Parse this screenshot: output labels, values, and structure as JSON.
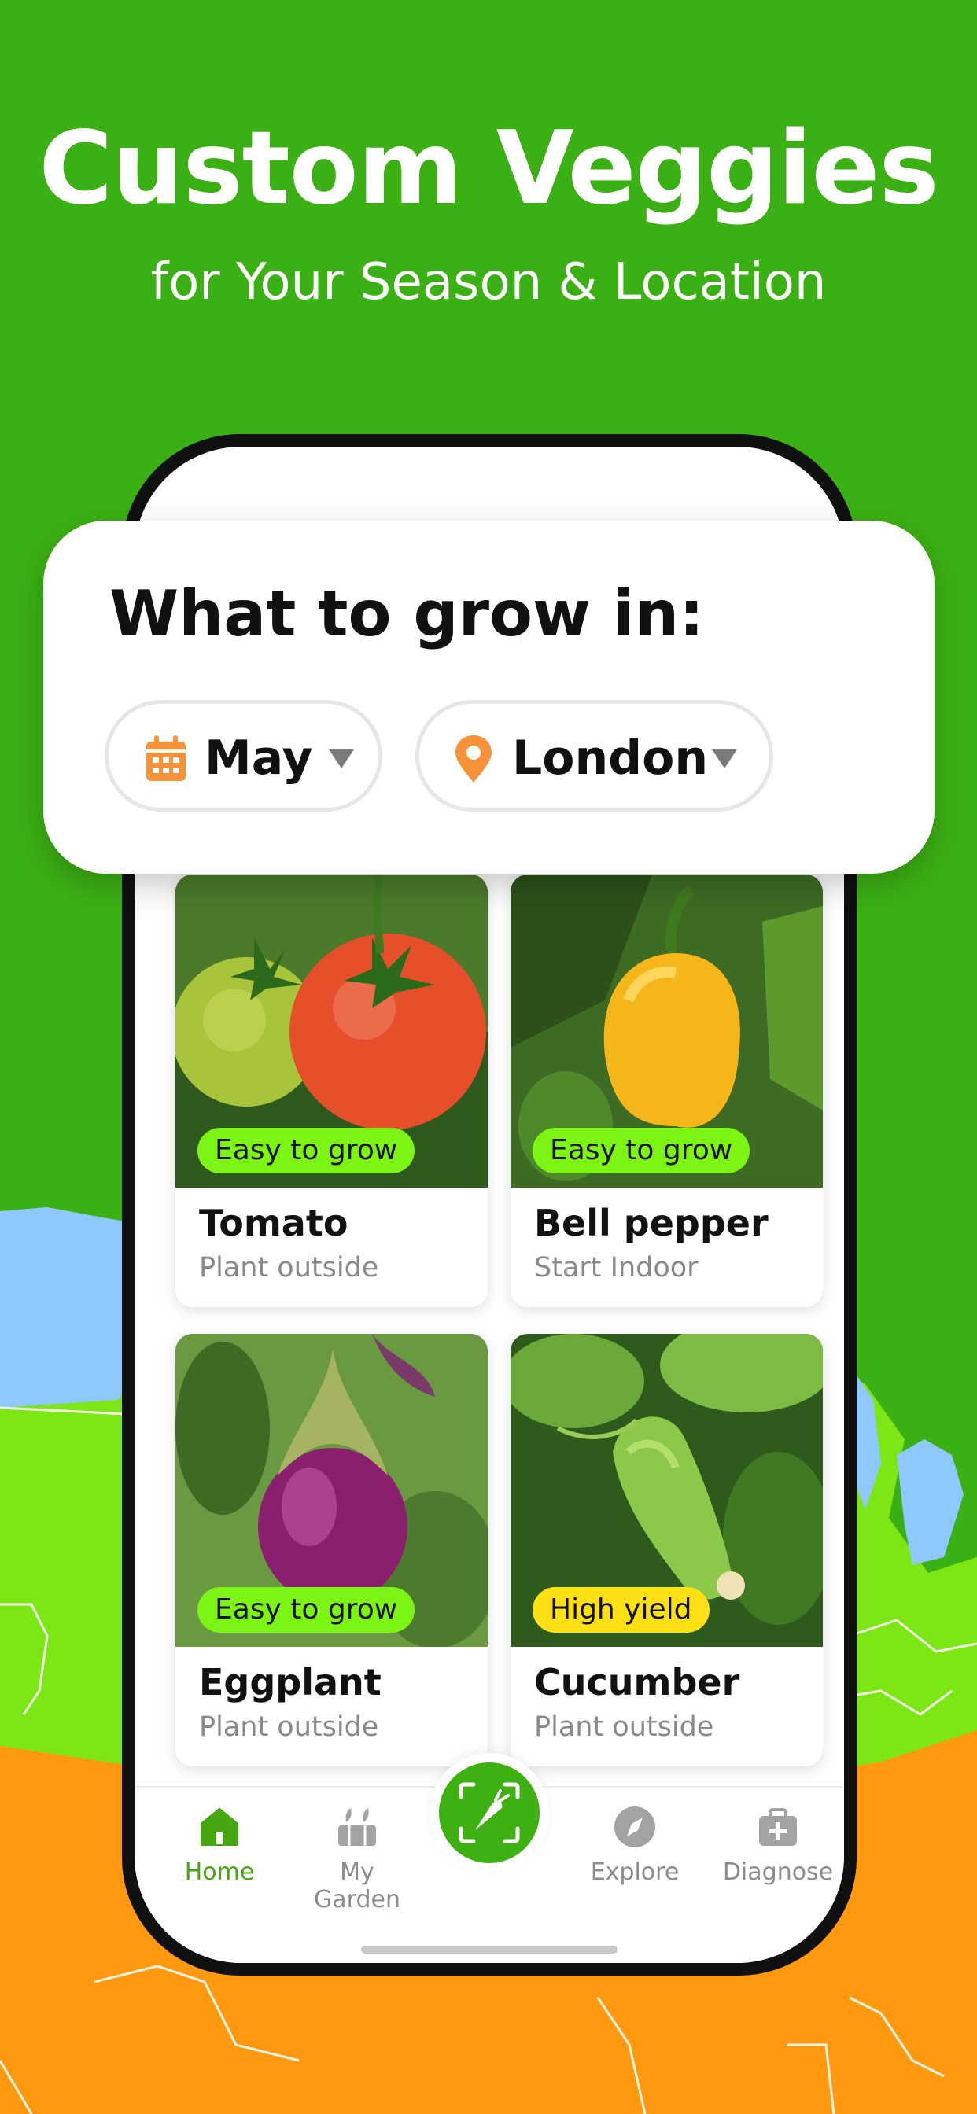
{
  "headline": "Custom Veggies",
  "subheadline": "for Your Season & Location",
  "selector": {
    "title": "What to grow in:",
    "month": "May",
    "location": "London"
  },
  "plants": [
    {
      "name": "Tomato",
      "subtitle": "Plant outside",
      "badge": "Easy to grow",
      "badge_color": "#7df514"
    },
    {
      "name": "Bell pepper",
      "subtitle": "Start Indoor",
      "badge": "Easy to grow",
      "badge_color": "#7df514"
    },
    {
      "name": "Eggplant",
      "subtitle": "Plant outside",
      "badge": "Easy to grow",
      "badge_color": "#7df514"
    },
    {
      "name": "Cucumber",
      "subtitle": "Plant outside",
      "badge": "High yield",
      "badge_color": "#ffe014"
    }
  ],
  "tabs": {
    "home": "Home",
    "my_garden": "My Garden",
    "explore": "Explore",
    "diagnose": "Diagnose"
  },
  "colors": {
    "brand_green": "#3bb014",
    "active_tab": "#46a80f",
    "accent_orange": "#f5923a"
  }
}
